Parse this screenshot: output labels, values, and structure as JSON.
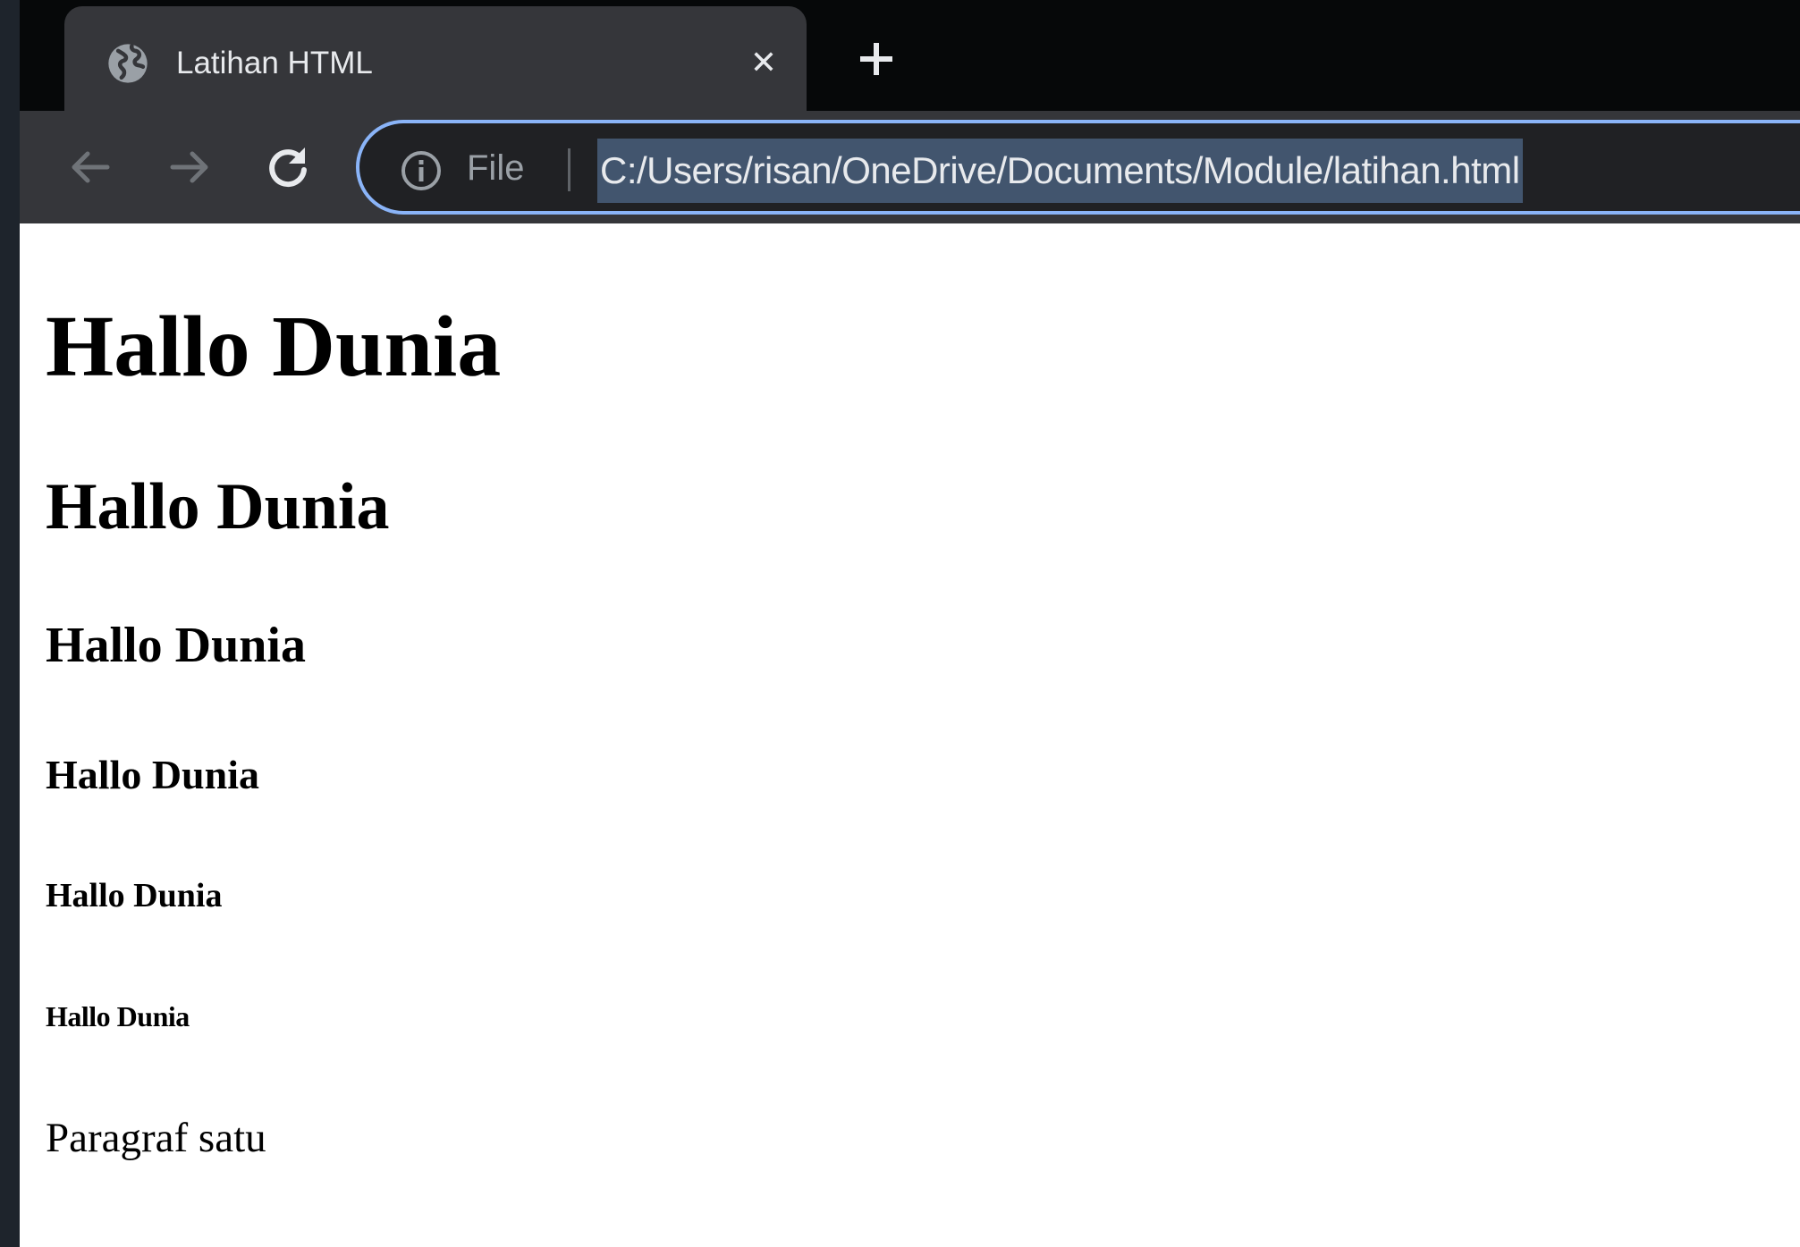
{
  "tab": {
    "title": "Latihan HTML",
    "favicon": "globe-icon",
    "close_icon": "close-icon",
    "close_glyph": "✕"
  },
  "tabstrip": {
    "new_tab_icon": "plus-icon"
  },
  "toolbar": {
    "back_icon": "arrow-left-icon",
    "forward_icon": "arrow-right-icon",
    "reload_icon": "reload-icon"
  },
  "omnibox": {
    "info_icon": "info-icon",
    "scheme": "File",
    "url": "C:/Users/risan/OneDrive/Documents/Module/latihan.html",
    "url_selected": true,
    "focus_color": "#8ab4f8",
    "selection_color": "#42556e"
  },
  "page": {
    "headings": [
      "Hallo Dunia",
      "Hallo Dunia",
      "Hallo Dunia",
      "Hallo Dunia",
      "Hallo Dunia",
      "Hallo Dunia"
    ],
    "paragraph": "Paragraf satu"
  },
  "colors": {
    "tabstrip_bg": "#060809",
    "active_tab_bg": "#35363a",
    "omnibox_bg": "#202124",
    "page_bg": "#ffffff",
    "text": "#000000"
  }
}
